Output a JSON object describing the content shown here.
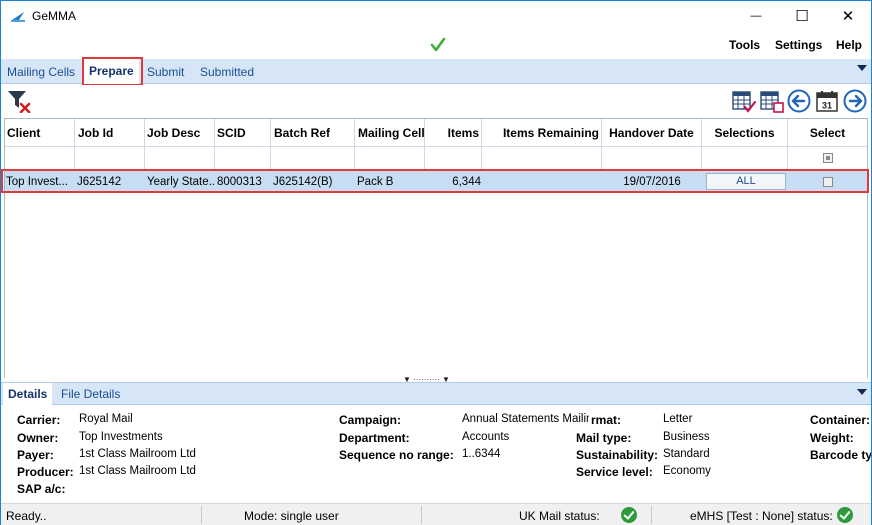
{
  "window": {
    "title": "GeMMA",
    "minimize_glyph": "—",
    "maximize_glyph": "☐",
    "close_glyph": "✕"
  },
  "menu": {
    "tools": "Tools",
    "settings": "Settings",
    "help": "Help"
  },
  "tabs": {
    "mailing_cells": "Mailing Cells",
    "prepare": "Prepare",
    "submit": "Submit",
    "submitted": "Submitted"
  },
  "grid": {
    "headers": [
      "Client",
      "Job Id",
      "Job Desc",
      "SCID",
      "Batch Ref",
      "Mailing Cell",
      "Items",
      "Items Remaining",
      "Handover Date",
      "Selections",
      "Select"
    ],
    "row": {
      "client": "Top Invest...",
      "job_id": "J625142",
      "job_desc": "Yearly State...",
      "scid": "8000313",
      "batch_ref": "J625142(B)",
      "mailing_cell": "Pack B",
      "items": "6,344",
      "items_remaining": "",
      "handover_date": "19/07/2016",
      "selections": "ALL"
    }
  },
  "detail_tabs": {
    "details": "Details",
    "file_details": "File Details"
  },
  "details": {
    "carrier_label": "Carrier:",
    "carrier": "Royal Mail",
    "owner_label": "Owner:",
    "owner": "Top Investments",
    "payer_label": "Payer:",
    "payer": "1st Class Mailroom Ltd",
    "producer_label": "Producer:",
    "producer": "1st Class Mailroom Ltd",
    "sap_label": "SAP a/c:",
    "campaign_label": "Campaign:",
    "campaign": "Annual Statements Mailing",
    "department_label": "Department:",
    "department": "Accounts",
    "sequence_label": "Sequence no range:",
    "sequence": "1..6344",
    "format_label": "rmat:",
    "format": "Letter",
    "mail_type_label": "Mail type:",
    "mail_type": "Business",
    "sustainability_label": "Sustainability:",
    "sustainability": "Standard",
    "service_level_label": "Service level:",
    "service_level": "Economy",
    "container_label": "Container:",
    "weight_label": "Weight:",
    "barcode_label": "Barcode ty"
  },
  "status": {
    "ready": "Ready..",
    "mode": "Mode: single user",
    "uk_mail": "UK Mail status:",
    "emhs": "eMHS [Test : None] status:"
  },
  "colors": {
    "accent": "#1b4e94",
    "tab_bg": "#d6e6f7",
    "selection": "#c6ddf3",
    "highlight": "#e03b3b",
    "ok": "#2e9a3c"
  }
}
